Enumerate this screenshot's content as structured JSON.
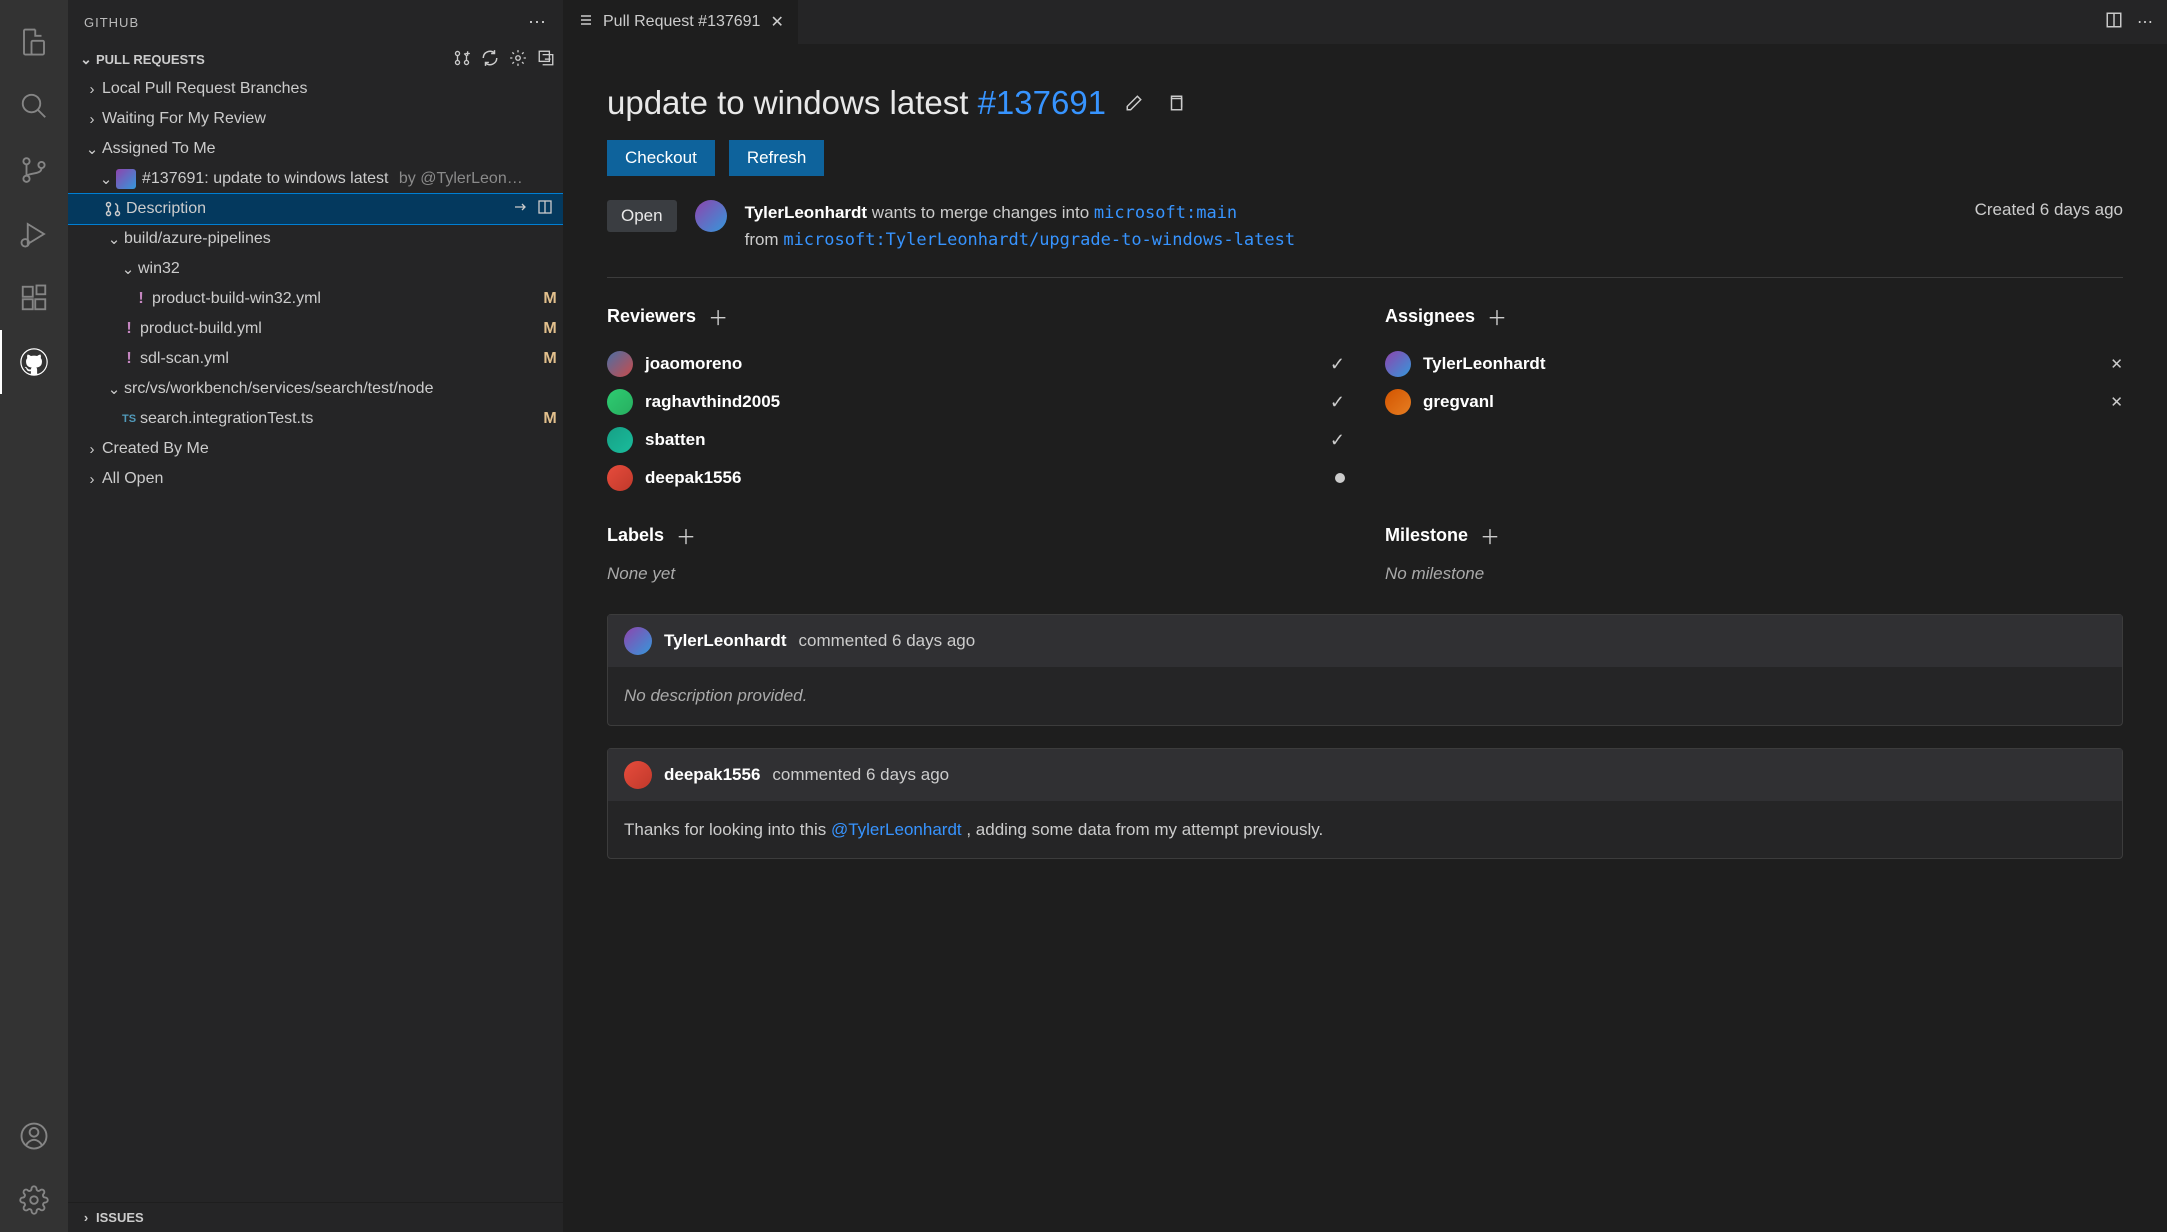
{
  "sidebar": {
    "title": "GITHUB",
    "sections": {
      "pull_requests": "PULL REQUESTS",
      "issues": "ISSUES"
    },
    "groups": {
      "local_branches": "Local Pull Request Branches",
      "waiting_review": "Waiting For My Review",
      "assigned": "Assigned To Me",
      "created": "Created By Me",
      "all_open": "All Open"
    },
    "pr": {
      "id": "#137691",
      "title": "update to windows latest",
      "by_prefix": "by ",
      "by": "@TylerLeon…",
      "description": "Description",
      "folders": {
        "build": "build/azure-pipelines",
        "win32": "win32",
        "src": "src/vs/workbench/services/search/test/node"
      },
      "files": {
        "product_build_win32": "product-build-win32.yml",
        "product_build": "product-build.yml",
        "sdl_scan": "sdl-scan.yml",
        "search_test": "search.integrationTest.ts"
      },
      "status_m": "M"
    }
  },
  "tab": {
    "label": "Pull Request #137691"
  },
  "pr_view": {
    "title": "update to windows latest",
    "number": "#137691",
    "checkout": "Checkout",
    "refresh": "Refresh",
    "status": "Open",
    "author": "TylerLeonhardt",
    "wants_to_merge": " wants to merge changes into ",
    "target_branch": "microsoft:main",
    "from_text": "from ",
    "source_branch": "microsoft:TylerLeonhardt/upgrade-to-windows-latest",
    "created": "Created 6 days ago",
    "sections": {
      "reviewers": "Reviewers",
      "assignees": "Assignees",
      "labels": "Labels",
      "milestone": "Milestone"
    },
    "reviewers": [
      {
        "name": "joaomoreno",
        "state": "check"
      },
      {
        "name": "raghavthind2005",
        "state": "check"
      },
      {
        "name": "sbatten",
        "state": "check"
      },
      {
        "name": "deepak1556",
        "state": "dot"
      }
    ],
    "assignees": [
      {
        "name": "TylerLeonhardt"
      },
      {
        "name": "gregvanl"
      }
    ],
    "labels_none": "None yet",
    "milestone_none": "No milestone",
    "timeline": [
      {
        "who": "TylerLeonhardt",
        "what": "commented 6 days ago",
        "body_empty": "No description provided."
      },
      {
        "who": "deepak1556",
        "what": "commented 6 days ago",
        "body_prefix": "Thanks for looking into this ",
        "mention": "@TylerLeonhardt",
        "body_suffix": " , adding some data from my attempt previously."
      }
    ]
  }
}
